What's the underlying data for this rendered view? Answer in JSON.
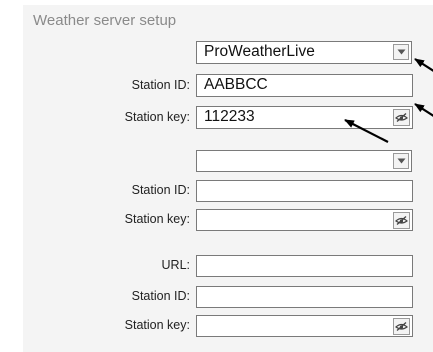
{
  "section": {
    "title": "Weather server setup"
  },
  "server1": {
    "selected": "ProWeatherLive",
    "station_id_label": "Station ID:",
    "station_id_value": "AABBCC",
    "station_key_label": "Station key:",
    "station_key_value": "112233"
  },
  "server2": {
    "selected": "",
    "station_id_label": "Station ID:",
    "station_id_value": "",
    "station_key_label": "Station key:",
    "station_key_value": ""
  },
  "server3": {
    "url_label": "URL:",
    "url_value": "",
    "station_id_label": "Station ID:",
    "station_id_value": "",
    "station_key_label": "Station key:",
    "station_key_value": ""
  },
  "icons": {
    "dropdown": "chevron-down-icon",
    "visibility": "eye-slash-icon",
    "annotation": "arrow-icon"
  },
  "colors": {
    "panel_bg": "#f4f4f4",
    "title": "#8a8a8a",
    "border": "#7a7a7a"
  }
}
